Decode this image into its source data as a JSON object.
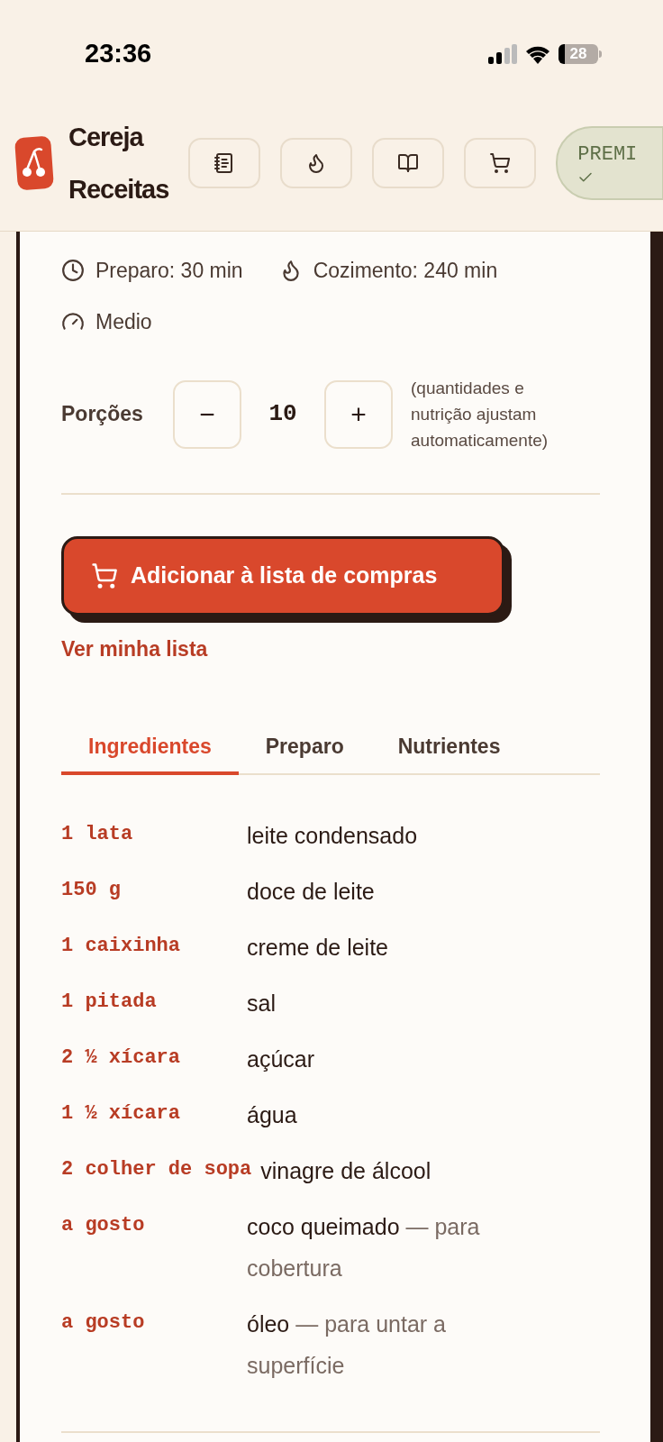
{
  "status_bar": {
    "time": "23:36",
    "battery": "28"
  },
  "header": {
    "brand": [
      "Cereja",
      "Receitas"
    ],
    "nav_buttons": [
      {
        "kind": "notebook"
      },
      {
        "kind": "flame"
      },
      {
        "kind": "book"
      },
      {
        "kind": "cart"
      }
    ],
    "premium": {
      "label": "PREMI",
      "checked": true
    }
  },
  "meta": [
    {
      "kind": "clock",
      "text": "Preparo: 30 min"
    },
    {
      "kind": "flame",
      "text": "Cozimento: 240 min"
    },
    {
      "kind": "gauge",
      "text": "Medio"
    }
  ],
  "servings": {
    "label": "Porções",
    "minus": "−",
    "value": "10",
    "plus": "+",
    "hint": "(quantidades e nutrição ajustam automaticamente)"
  },
  "add_button": "Adicionar à lista de compras",
  "list_link": "Ver minha lista",
  "tabs": [
    {
      "label": "Ingredientes",
      "selected": true
    },
    {
      "label": "Preparo",
      "selected": false
    },
    {
      "label": "Nutrientes",
      "selected": false
    }
  ],
  "ingredients": [
    {
      "quantity": "1 lata",
      "name": "leite condensado"
    },
    {
      "quantity": "150 g",
      "name": "doce de leite"
    },
    {
      "quantity": "1 caixinha",
      "name": "creme de leite"
    },
    {
      "quantity": "1 pitada",
      "name": "sal"
    },
    {
      "quantity": "2 ½ xícara",
      "name": "açúcar"
    },
    {
      "quantity": "1 ½ xícara",
      "name": "água"
    },
    {
      "quantity": "2 colher de sopa",
      "name": "vinagre de álcool"
    },
    {
      "quantity": "a gosto",
      "name": "coco queimado",
      "note": "— para cobertura"
    },
    {
      "quantity": "a gosto",
      "name": "óleo",
      "note": "— para untar a superfície"
    }
  ]
}
